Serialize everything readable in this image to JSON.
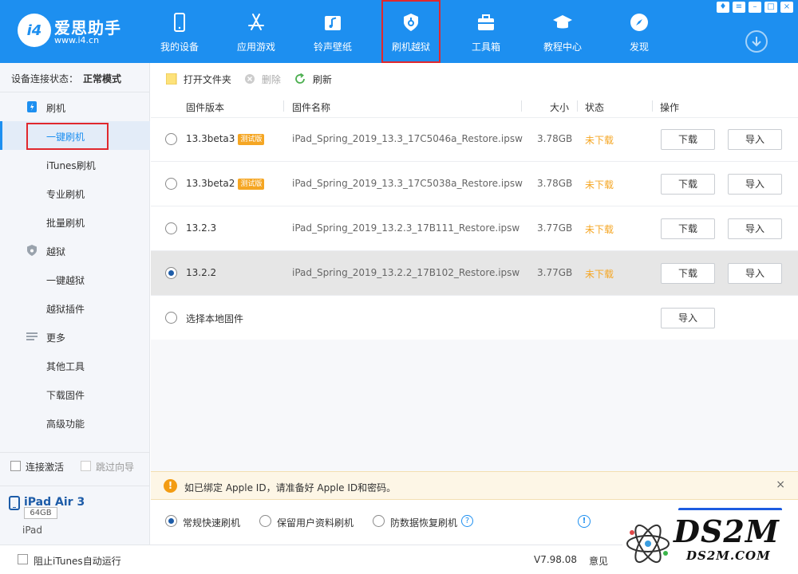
{
  "brand": {
    "title": "爱思助手",
    "url": "www.i4.cn"
  },
  "nav": [
    {
      "label": "我的设备",
      "icon": "phone-icon"
    },
    {
      "label": "应用游戏",
      "icon": "app-store-icon"
    },
    {
      "label": "铃声壁纸",
      "icon": "music-icon"
    },
    {
      "label": "刷机越狱",
      "icon": "flash-shield-icon"
    },
    {
      "label": "工具箱",
      "icon": "toolbox-icon"
    },
    {
      "label": "教程中心",
      "icon": "graduation-cap-icon"
    },
    {
      "label": "发现",
      "icon": "compass-icon"
    }
  ],
  "window_buttons": [
    "shirt-icon",
    "menu-icon",
    "minimize-icon",
    "maximize-icon",
    "close-icon"
  ],
  "sidebar": {
    "status_label": "设备连接状态：",
    "status_value": "正常模式",
    "groups": [
      {
        "label": "刷机",
        "icon": "flash-icon",
        "items": [
          "一键刷机",
          "iTunes刷机",
          "专业刷机",
          "批量刷机"
        ]
      },
      {
        "label": "越狱",
        "icon": "shield-icon",
        "items": [
          "一键越狱",
          "越狱插件"
        ]
      },
      {
        "label": "更多",
        "icon": "list-icon",
        "items": [
          "其他工具",
          "下载固件",
          "高级功能"
        ]
      }
    ],
    "active_item": "一键刷机",
    "auto_activate": "连接激活",
    "skip_guide": "跳过向导",
    "device": {
      "name": "iPad Air 3",
      "capacity": "64GB",
      "type": "iPad"
    }
  },
  "toolbar": {
    "open_folder": "打开文件夹",
    "delete": "删除",
    "refresh": "刷新"
  },
  "columns": {
    "version": "固件版本",
    "name": "固件名称",
    "size": "大小",
    "status": "状态",
    "action": "操作"
  },
  "firmware": [
    {
      "version": "13.3beta3",
      "badge": "测试版",
      "name": "iPad_Spring_2019_13.3_17C5046a_Restore.ipsw",
      "size": "3.78GB",
      "status": "未下载",
      "download": "下载",
      "import": "导入",
      "selected": false
    },
    {
      "version": "13.3beta2",
      "badge": "测试版",
      "name": "iPad_Spring_2019_13.3_17C5038a_Restore.ipsw",
      "size": "3.78GB",
      "status": "未下载",
      "download": "下载",
      "import": "导入",
      "selected": false
    },
    {
      "version": "13.2.3",
      "badge": "",
      "name": "iPad_Spring_2019_13.2.3_17B111_Restore.ipsw",
      "size": "3.77GB",
      "status": "未下载",
      "download": "下载",
      "import": "导入",
      "selected": false
    },
    {
      "version": "13.2.2",
      "badge": "",
      "name": "iPad_Spring_2019_13.2.2_17B102_Restore.ipsw",
      "size": "3.77GB",
      "status": "未下载",
      "download": "下载",
      "import": "导入",
      "selected": true
    }
  ],
  "local": {
    "label": "选择本地固件",
    "import": "导入"
  },
  "notice": {
    "text": "如已绑定 Apple ID，请准备好 Apple ID和密码。",
    "close": "×"
  },
  "modes": [
    {
      "label": "常规快速刷机",
      "selected": true
    },
    {
      "label": "保留用户资料刷机",
      "selected": false
    },
    {
      "label": "防数据恢复刷机",
      "selected": false
    }
  ],
  "statusbar": {
    "block_itunes": "阻止iTunes自动运行",
    "version": "V7.98.08",
    "feedback": "意见"
  },
  "watermark": {
    "big": "DS2M",
    "small": "DS2M.COM"
  },
  "colors": {
    "brand_blue": "#1d8ff0",
    "highlight_red": "#e0282e",
    "status_orange": "#f5a623"
  }
}
